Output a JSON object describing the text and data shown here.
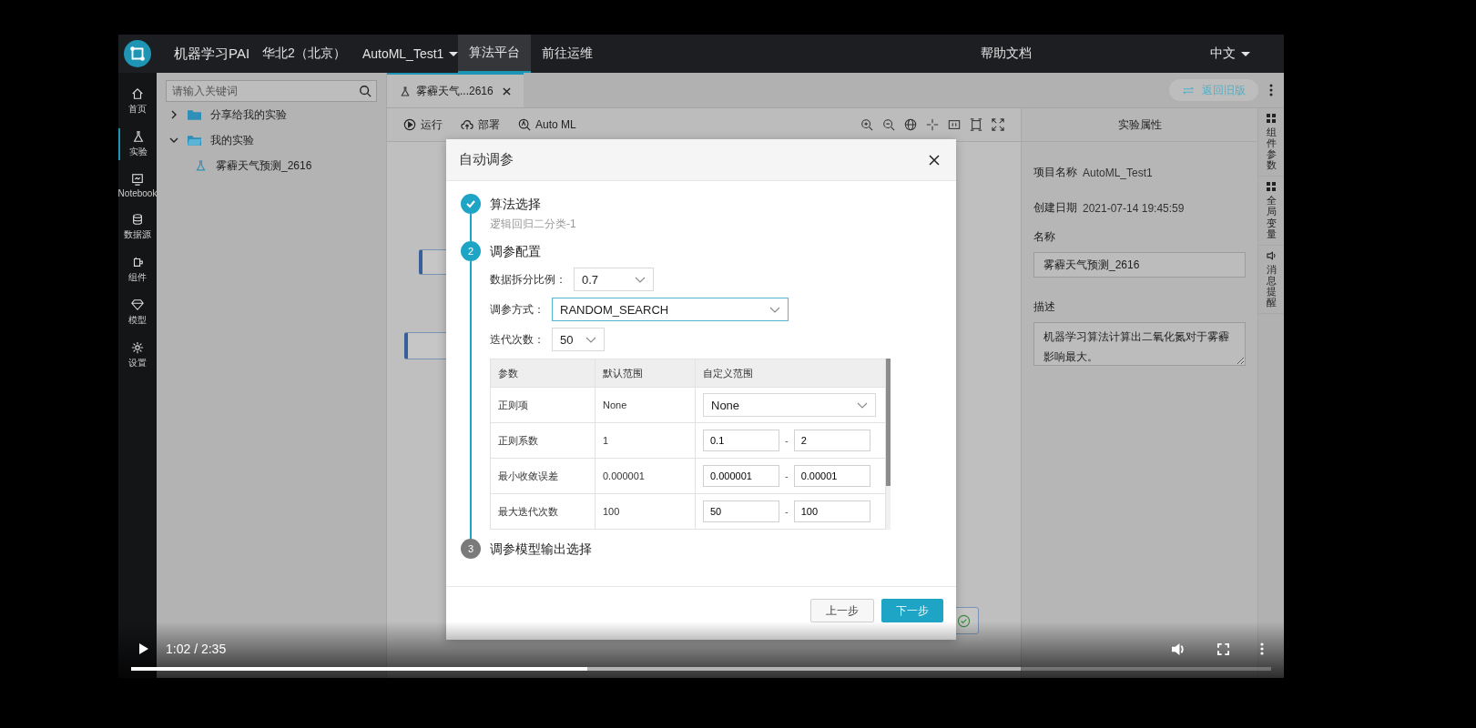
{
  "video_player": {
    "playing": false,
    "time": "1:02 / 2:35",
    "progress": {
      "level": 0.4
    },
    "buffered": {
      "level": 0.78
    }
  },
  "app": {
    "top_bar": {
      "product": "机器学习PAI",
      "region": "华北2（北京）",
      "project": "AutoML_Test1",
      "nav": [
        {
          "label": "算法平台",
          "selected": true
        },
        {
          "label": "前往运维",
          "selected": false
        }
      ],
      "help": "帮助文档",
      "language": "中文"
    },
    "rail": [
      {
        "label": "首页",
        "kind": "home",
        "selected": false
      },
      {
        "label": "实验",
        "kind": "flask",
        "selected": true
      },
      {
        "label": "Notebook",
        "kind": "notebook",
        "selected": false
      },
      {
        "label": "数据源",
        "kind": "database",
        "selected": false
      },
      {
        "label": "组件",
        "kind": "component",
        "selected": false
      },
      {
        "label": "模型",
        "kind": "diamond",
        "selected": false
      },
      {
        "label": "设置",
        "kind": "gear",
        "selected": false
      }
    ],
    "sidebar": {
      "search": {
        "placeholder": "请输入关键词"
      },
      "tree": [
        {
          "label": "分享给我的实验",
          "kind": "folder",
          "expanded": false
        },
        {
          "label": "我的实验",
          "kind": "folder",
          "expanded": true,
          "children": [
            {
              "label": "雾霾天气预测_2616",
              "kind": "experiment"
            }
          ]
        }
      ]
    },
    "tabs": [
      {
        "label": "雾霾天气...2616",
        "selected": true
      }
    ],
    "back_button": "返回旧版",
    "toolbar": [
      {
        "label": "运行",
        "kind": "run"
      },
      {
        "label": "部署",
        "kind": "deploy"
      },
      {
        "label": "Auto ML",
        "kind": "automl"
      }
    ],
    "properties": {
      "title": "实验属性",
      "fields": [
        {
          "label": "项目名称",
          "value": "AutoML_Test1"
        },
        {
          "label": "创建日期",
          "value": "2021-07-14 19:45:59"
        }
      ],
      "name": {
        "label": "名称",
        "value": "雾霾天气预测_2616"
      },
      "description": {
        "label": "描述",
        "value": "机器学习算法计算出二氧化氮对于雾霾影响最大。"
      }
    },
    "side_tabs": [
      {
        "label": "组件参数",
        "kind": "grid"
      },
      {
        "label": "全局变量",
        "kind": "grid"
      },
      {
        "label": "消息提醒",
        "kind": "sound"
      }
    ]
  },
  "dialog": {
    "title": "自动调参",
    "steps": [
      {
        "title": "算法选择",
        "kind": "done",
        "subtitle": "逻辑回归二分类-1"
      },
      {
        "number": "2",
        "title": "调参配置",
        "kind": "active"
      },
      {
        "number": "3",
        "title": "调参模型输出选择",
        "kind": "pending"
      }
    ],
    "form": [
      {
        "label": "数据拆分比例：",
        "value": "0.7",
        "focused": false
      },
      {
        "label": "调参方式：",
        "value": "RANDOM_SEARCH",
        "focused": true
      },
      {
        "label": "迭代次数：",
        "value": "50",
        "focused": false
      }
    ],
    "table": {
      "columns": [
        "参数",
        "默认范围",
        "自定义范围"
      ],
      "rows": [
        {
          "param": "正则项",
          "default": "None",
          "kind": "select",
          "value": "None"
        },
        {
          "param": "正则系数",
          "default": "1",
          "kind": "range",
          "min": "0.1",
          "dash": "-",
          "max": "2"
        },
        {
          "param": "最小收敛误差",
          "default": "0.000001",
          "kind": "range",
          "min": "0.000001",
          "dash": "-",
          "max": "0.00001"
        },
        {
          "param": "最大迭代次数",
          "default": "100",
          "kind": "range",
          "min": "50",
          "dash": "-",
          "max": "100"
        }
      ]
    },
    "buttons": [
      {
        "label": "上一步",
        "kind": "secondary"
      },
      {
        "label": "下一步",
        "kind": "primary"
      }
    ]
  }
}
